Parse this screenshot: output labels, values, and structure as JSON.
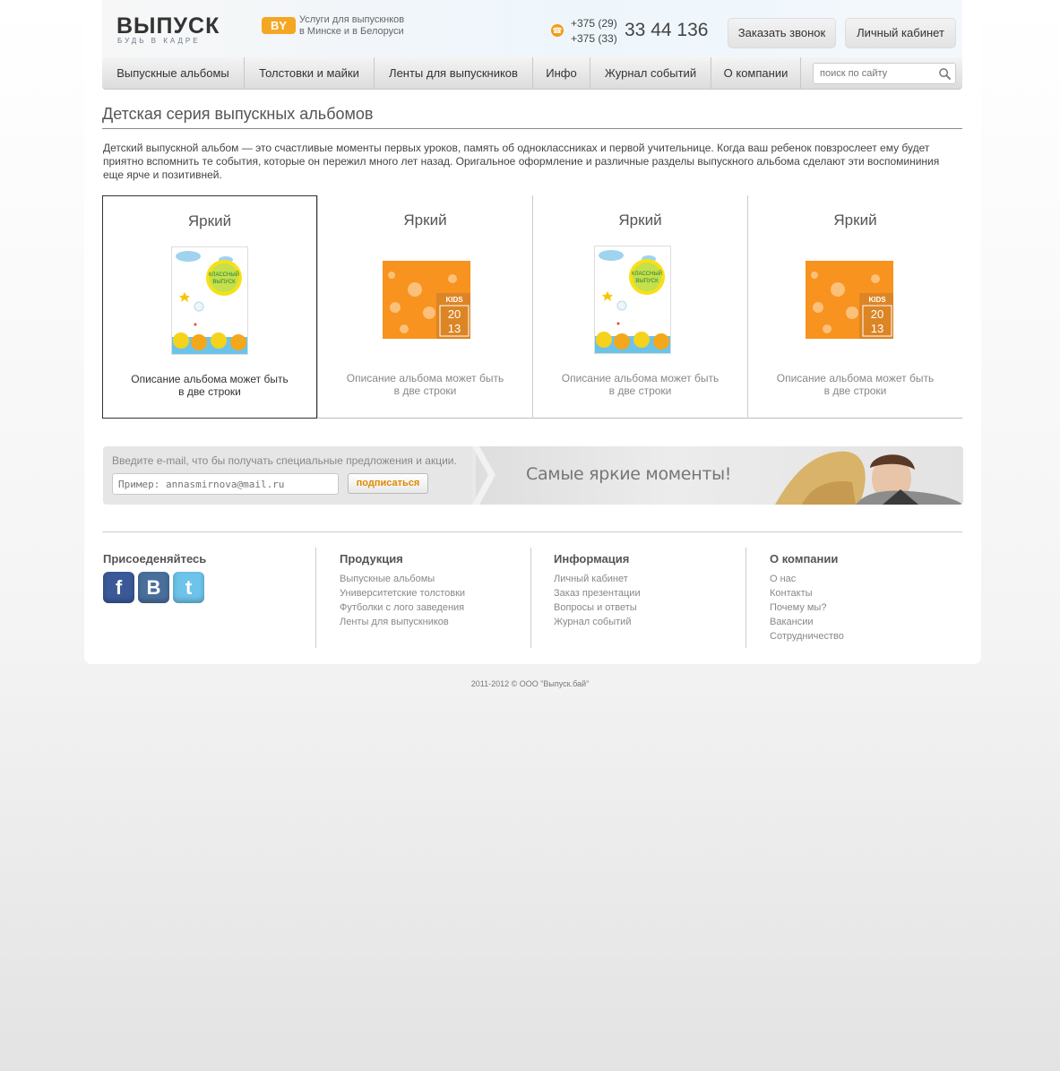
{
  "header": {
    "logo_text": "ВЫПУСК",
    "logo_badge": "BY",
    "logo_slogan": "БУДЬ В КАДРЕ",
    "services_line1": "Услуги для выпускнков",
    "services_line2": "в Минске и в Белоруси",
    "phone_code1": "+375 (29)",
    "phone_code2": "+375 (33)",
    "phone_number": "33 44 136",
    "call_button": "Заказать звонок",
    "cabinet_button": "Личный кабинет"
  },
  "nav": {
    "items": [
      {
        "label": "Выпускные альбомы"
      },
      {
        "label": "Толстовки и майки"
      },
      {
        "label": "Ленты для выпускников"
      },
      {
        "label": "Инфо"
      },
      {
        "label": "Журнал событий"
      },
      {
        "label": "О компании"
      }
    ],
    "search_placeholder": "поиск по сайту"
  },
  "page": {
    "title": "Детская серия выпускных альбомов",
    "intro": "Детский выпускной альбом — это счастливые моменты первых уроков, память об одноклассниках и первой учительнице. Когда ваш ребенок повзрослеет ему будет приятно вспомнить те события, которые он пережил много лет назад. Оригальное оформление и различные разделы выпускного альбома сделают эти воспомининия еще ярче и позитивней."
  },
  "albums": [
    {
      "title": "Яркий",
      "desc_line1": "Описание альбома может быть",
      "desc_line2": "в две строки",
      "cover": "portrait",
      "active": true
    },
    {
      "title": "Яркий",
      "desc_line1": "Описание альбома может быть",
      "desc_line2": "в две строки",
      "cover": "square",
      "active": false
    },
    {
      "title": "Яркий",
      "desc_line1": "Описание альбома может быть",
      "desc_line2": "в две строки",
      "cover": "portrait",
      "active": false
    },
    {
      "title": "Яркий",
      "desc_line1": "Описание альбома может быть",
      "desc_line2": "в две строки",
      "cover": "square",
      "active": false
    }
  ],
  "cover_text": {
    "portrait_badge_line1": "КЛАССНЫЙ",
    "portrait_badge_line2": "ВЫПУСК",
    "kids": "KIDS",
    "year_top": "20",
    "year_bottom": "13"
  },
  "subscribe": {
    "label": "Введите e-mail, что бы получать специальные предложения и акции.",
    "placeholder": "Пример: annasmirnova@mail.ru",
    "button": "подписаться",
    "slogan": "Самые яркие моменты!"
  },
  "footer": {
    "join": {
      "title": "Присоеденяйтесь",
      "networks": [
        "f",
        "B",
        "t"
      ]
    },
    "products": {
      "title": "Продукция",
      "links": [
        "Выпускные альбомы",
        "Университетские толстовки",
        "Футболки с лого заведения",
        "Ленты для выпускников"
      ]
    },
    "info": {
      "title": "Информация",
      "links": [
        "Личный кабинет",
        "Заказ презентации",
        "Вопросы и ответы",
        "Журнал событий"
      ]
    },
    "company": {
      "title": "О компании",
      "links": [
        "О нас",
        "Контакты",
        "Почему мы?",
        "Вакансии",
        "Сотрудничество"
      ]
    },
    "copyright": "2011-2012  ©  ООО \"Выпуск.бай\""
  },
  "colors": {
    "accent": "#f5a623",
    "cover_orange": "#f7931e",
    "subscribe_button_text": "#e08a00"
  }
}
